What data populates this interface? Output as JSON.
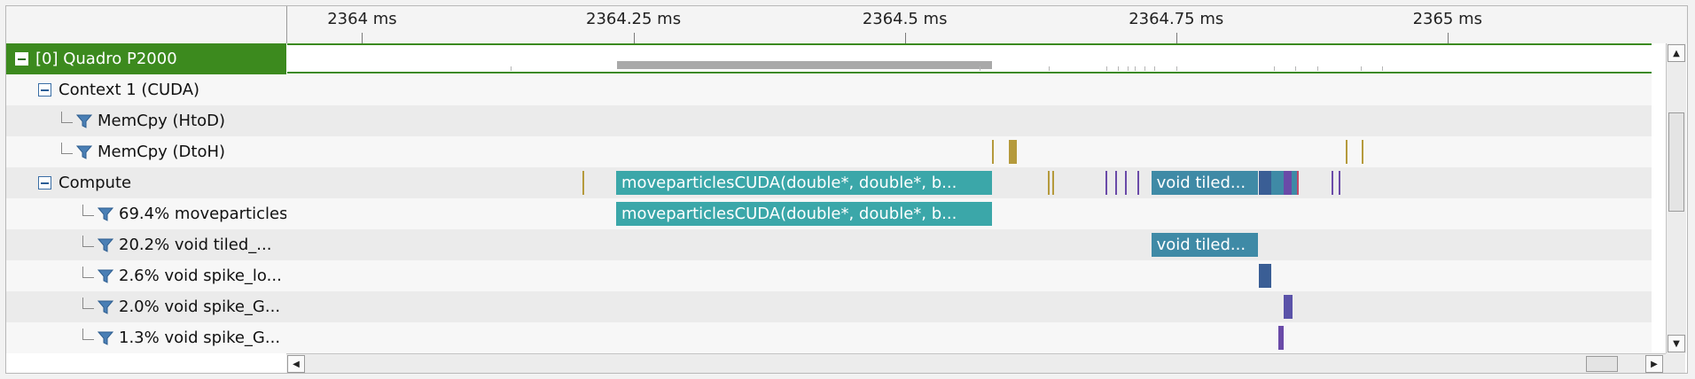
{
  "timeline": {
    "ruler": {
      "ticks": [
        {
          "label": "2364 ms",
          "value": 2364.0
        },
        {
          "label": "2364.25 ms",
          "value": 2364.25
        },
        {
          "label": "2364.5 ms",
          "value": 2364.5
        },
        {
          "label": "2364.75 ms",
          "value": 2364.75
        },
        {
          "label": "2365 ms",
          "value": 2365.0
        }
      ]
    },
    "view": {
      "start_ms": 2363.931,
      "end_ms": 2365.188
    },
    "colors": {
      "gpu_green": "#3c8a1e",
      "teal": "#3ba7a9",
      "steel": "#3f8aa6",
      "gold": "#b59a3c",
      "purple": "#6a4aa8",
      "navy": "#3a5e95",
      "gray": "#a9a9a9"
    },
    "rows": [
      {
        "id": "gpu",
        "label": "[0] Quadro P2000",
        "indent": 0,
        "type": "gpu",
        "icon": "collapse-icon",
        "gpu_bars": [
          {
            "start": 2364.235,
            "end": 2364.58
          }
        ],
        "gpu_ticks": [
          2364.137,
          2364.569,
          2364.633,
          2364.686,
          2364.696,
          2364.705,
          2364.712,
          2364.721,
          2364.73,
          2364.75,
          2364.84,
          2364.86,
          2364.88,
          2364.92,
          2364.94
        ]
      },
      {
        "id": "context",
        "label": "Context 1 (CUDA)",
        "indent": 1,
        "type": "expander",
        "icon": "collapse-icon",
        "events": []
      },
      {
        "id": "htod",
        "label": "MemCpy (HtoD)",
        "indent": 2,
        "type": "filter",
        "icon": "filter-icon",
        "events": []
      },
      {
        "id": "dtoh",
        "label": "MemCpy (DtoH)",
        "indent": 2,
        "type": "filter",
        "icon": "filter-icon",
        "events": [
          {
            "start": 2364.58,
            "end": 2364.581,
            "color": "#b59a3c"
          },
          {
            "start": 2364.596,
            "end": 2364.603,
            "color": "#b59a3c"
          },
          {
            "start": 2364.906,
            "end": 2364.907,
            "color": "#b59a3c"
          },
          {
            "start": 2364.921,
            "end": 2364.922,
            "color": "#b59a3c"
          }
        ]
      },
      {
        "id": "compute",
        "label": "Compute",
        "indent": 1,
        "type": "expander",
        "icon": "collapse-icon",
        "events": [
          {
            "start": 2364.203,
            "end": 2364.204,
            "color": "#b59a3c"
          },
          {
            "start": 2364.234,
            "end": 2364.58,
            "color": "#3ba7a9",
            "text": "moveparticlesCUDA(double*, double*, b..."
          },
          {
            "start": 2364.632,
            "end": 2364.633,
            "color": "#b59a3c"
          },
          {
            "start": 2364.636,
            "end": 2364.637,
            "color": "#b59a3c"
          },
          {
            "start": 2364.685,
            "end": 2364.686,
            "color": "#6a4aa8"
          },
          {
            "start": 2364.694,
            "end": 2364.695,
            "color": "#6a4aa8"
          },
          {
            "start": 2364.703,
            "end": 2364.704,
            "color": "#6a4aa8"
          },
          {
            "start": 2364.714,
            "end": 2364.715,
            "color": "#6a4aa8"
          },
          {
            "start": 2364.727,
            "end": 2364.825,
            "color": "#3f8aa6",
            "text": "void tiled..."
          },
          {
            "start": 2364.826,
            "end": 2364.838,
            "color": "#3a5e95"
          },
          {
            "start": 2364.838,
            "end": 2364.849,
            "color": "#3f8aa6"
          },
          {
            "start": 2364.849,
            "end": 2364.856,
            "color": "#6a4aa8"
          },
          {
            "start": 2364.856,
            "end": 2364.861,
            "color": "#3f8aa6"
          },
          {
            "start": 2364.861,
            "end": 2364.862,
            "color": "#c04a6a"
          },
          {
            "start": 2364.893,
            "end": 2364.894,
            "color": "#6a4aa8"
          },
          {
            "start": 2364.9,
            "end": 2364.901,
            "color": "#6a4aa8"
          }
        ]
      },
      {
        "id": "k1",
        "label": "69.4% moveparticles...",
        "indent": 3,
        "type": "filter",
        "icon": "filter-icon",
        "events": [
          {
            "start": 2364.234,
            "end": 2364.58,
            "color": "#3ba7a9",
            "text": "moveparticlesCUDA(double*, double*, b..."
          }
        ]
      },
      {
        "id": "k2",
        "label": "20.2% void tiled_...",
        "indent": 3,
        "type": "filter",
        "icon": "filter-icon",
        "events": [
          {
            "start": 2364.727,
            "end": 2364.825,
            "color": "#3f8aa6",
            "text": "void tiled..."
          }
        ]
      },
      {
        "id": "k3",
        "label": "2.6% void spike_lo...",
        "indent": 3,
        "type": "filter",
        "icon": "filter-icon",
        "events": [
          {
            "start": 2364.826,
            "end": 2364.838,
            "color": "#3a5e95"
          }
        ]
      },
      {
        "id": "k4",
        "label": "2.0% void spike_G...",
        "indent": 3,
        "type": "filter",
        "icon": "filter-icon",
        "events": [
          {
            "start": 2364.849,
            "end": 2364.857,
            "color": "#5a52a8"
          }
        ]
      },
      {
        "id": "k5",
        "label": "1.3% void spike_G...",
        "indent": 3,
        "type": "filter",
        "icon": "filter-icon",
        "events": [
          {
            "start": 2364.844,
            "end": 2364.849,
            "color": "#6a4aa8"
          }
        ]
      }
    ]
  },
  "scrollbars": {
    "vertical": {
      "up_icon": "arrow-up-icon",
      "down_icon": "arrow-down-icon"
    },
    "horizontal": {
      "left_icon": "arrow-left-icon",
      "right_icon": "arrow-right-icon"
    }
  }
}
